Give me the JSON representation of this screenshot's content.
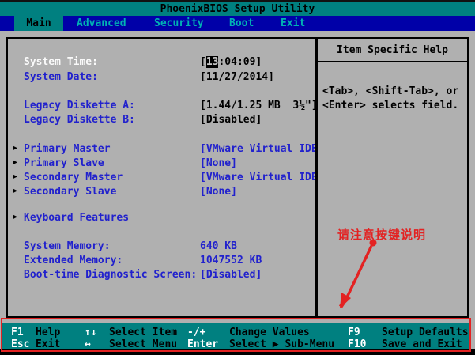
{
  "title_bar": {
    "title": "PhoenixBIOS Setup Utility"
  },
  "menu": {
    "tabs": [
      {
        "label": "Main",
        "active": true
      },
      {
        "label": "Advanced",
        "active": false
      },
      {
        "label": "Security",
        "active": false
      },
      {
        "label": "Boot",
        "active": false
      },
      {
        "label": "Exit",
        "active": false
      }
    ]
  },
  "main": {
    "rows": [
      {
        "label": "System Time:",
        "value_pre": "[",
        "value_sel": "13",
        "value_post": ":04:09]"
      },
      {
        "label": "System Date:",
        "value": "[11/27/2014]"
      },
      {
        "label": "Legacy Diskette A:",
        "value": "[1.44/1.25 MB  3½\"]"
      },
      {
        "label": "Legacy Diskette B:",
        "value": "[Disabled]"
      },
      {
        "label": "Primary Master",
        "value": "[VMware Virtual IDE",
        "submenu": true
      },
      {
        "label": "Primary Slave",
        "value": "[None]",
        "submenu": true
      },
      {
        "label": "Secondary Master",
        "value": "[VMware Virtual IDE",
        "submenu": true
      },
      {
        "label": "Secondary Slave",
        "value": "[None]",
        "submenu": true
      },
      {
        "label": "Keyboard Features",
        "value": "",
        "submenu": true
      },
      {
        "label": "System Memory:",
        "value": "640 KB"
      },
      {
        "label": "Extended Memory:",
        "value": "1047552 KB"
      },
      {
        "label": "Boot-time Diagnostic Screen:",
        "value": "[Disabled]"
      }
    ],
    "submenu_arrow_icon": "▶"
  },
  "help": {
    "title": "Item Specific Help",
    "line1": "<Tab>, <Shift-Tab>, or",
    "line2": "<Enter> selects field."
  },
  "annotation": {
    "note": "请注意按键说明"
  },
  "keybar": {
    "row1": {
      "key1": "F1",
      "label1": "Help",
      "key2": "↑↓",
      "label2": "Select Item",
      "key3": "-/+",
      "label3": "Change Values",
      "key4": "F9",
      "label4": "Setup Defaults"
    },
    "row2": {
      "key1": "Esc",
      "label1": "Exit",
      "key2": "↔",
      "label2": "Select Menu",
      "key3": "Enter",
      "label3": "Select ▶ Sub-Menu",
      "key4": "F10",
      "label4": "Save and Exit"
    }
  },
  "colors": {
    "titlebar_teal": "#008080",
    "menubar_navy": "#0000a8",
    "panel_grey": "#b0b0b0",
    "label_blue": "#2121cd",
    "selected_label_white": "#fafafa",
    "annotation_red": "#e32222"
  }
}
